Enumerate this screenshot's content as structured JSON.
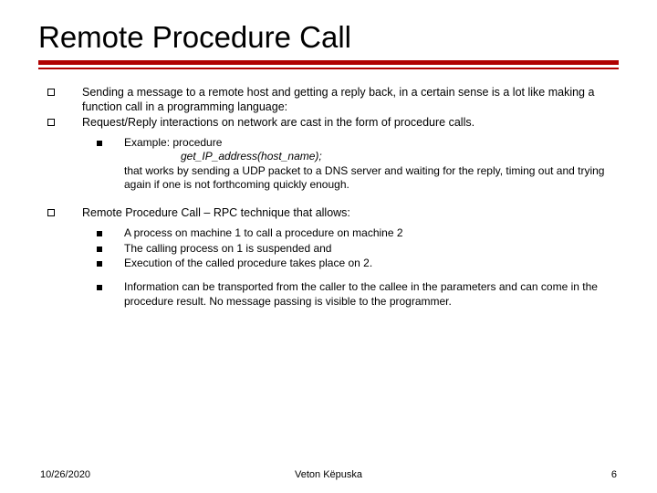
{
  "title": "Remote Procedure Call",
  "bullets": {
    "b1": "Sending a message to a remote host and getting a reply back, in a certain sense is a lot like making a function call in a programming language:",
    "b2": "Request/Reply interactions on network are cast in the form of procedure calls.",
    "ex_lead": "Example: procedure",
    "ex_code": "get_IP_address(host_name);",
    "ex_tail": "that works by sending a UDP packet to a DNS server and waiting for the reply, timing out and trying again if one is not forthcoming quickly enough.",
    "b3": "Remote Procedure Call – RPC technique that allows:",
    "s1": "A process on machine 1 to call a procedure on machine 2",
    "s2": "The calling process on 1 is suspended and",
    "s3": "Execution of the called procedure takes place on 2.",
    "s4": "Information can be transported from the caller to the callee in the parameters and can come in the procedure result. No message passing is visible to the programmer."
  },
  "footer": {
    "date": "10/26/2020",
    "author": "Veton Këpuska",
    "page": "6"
  }
}
